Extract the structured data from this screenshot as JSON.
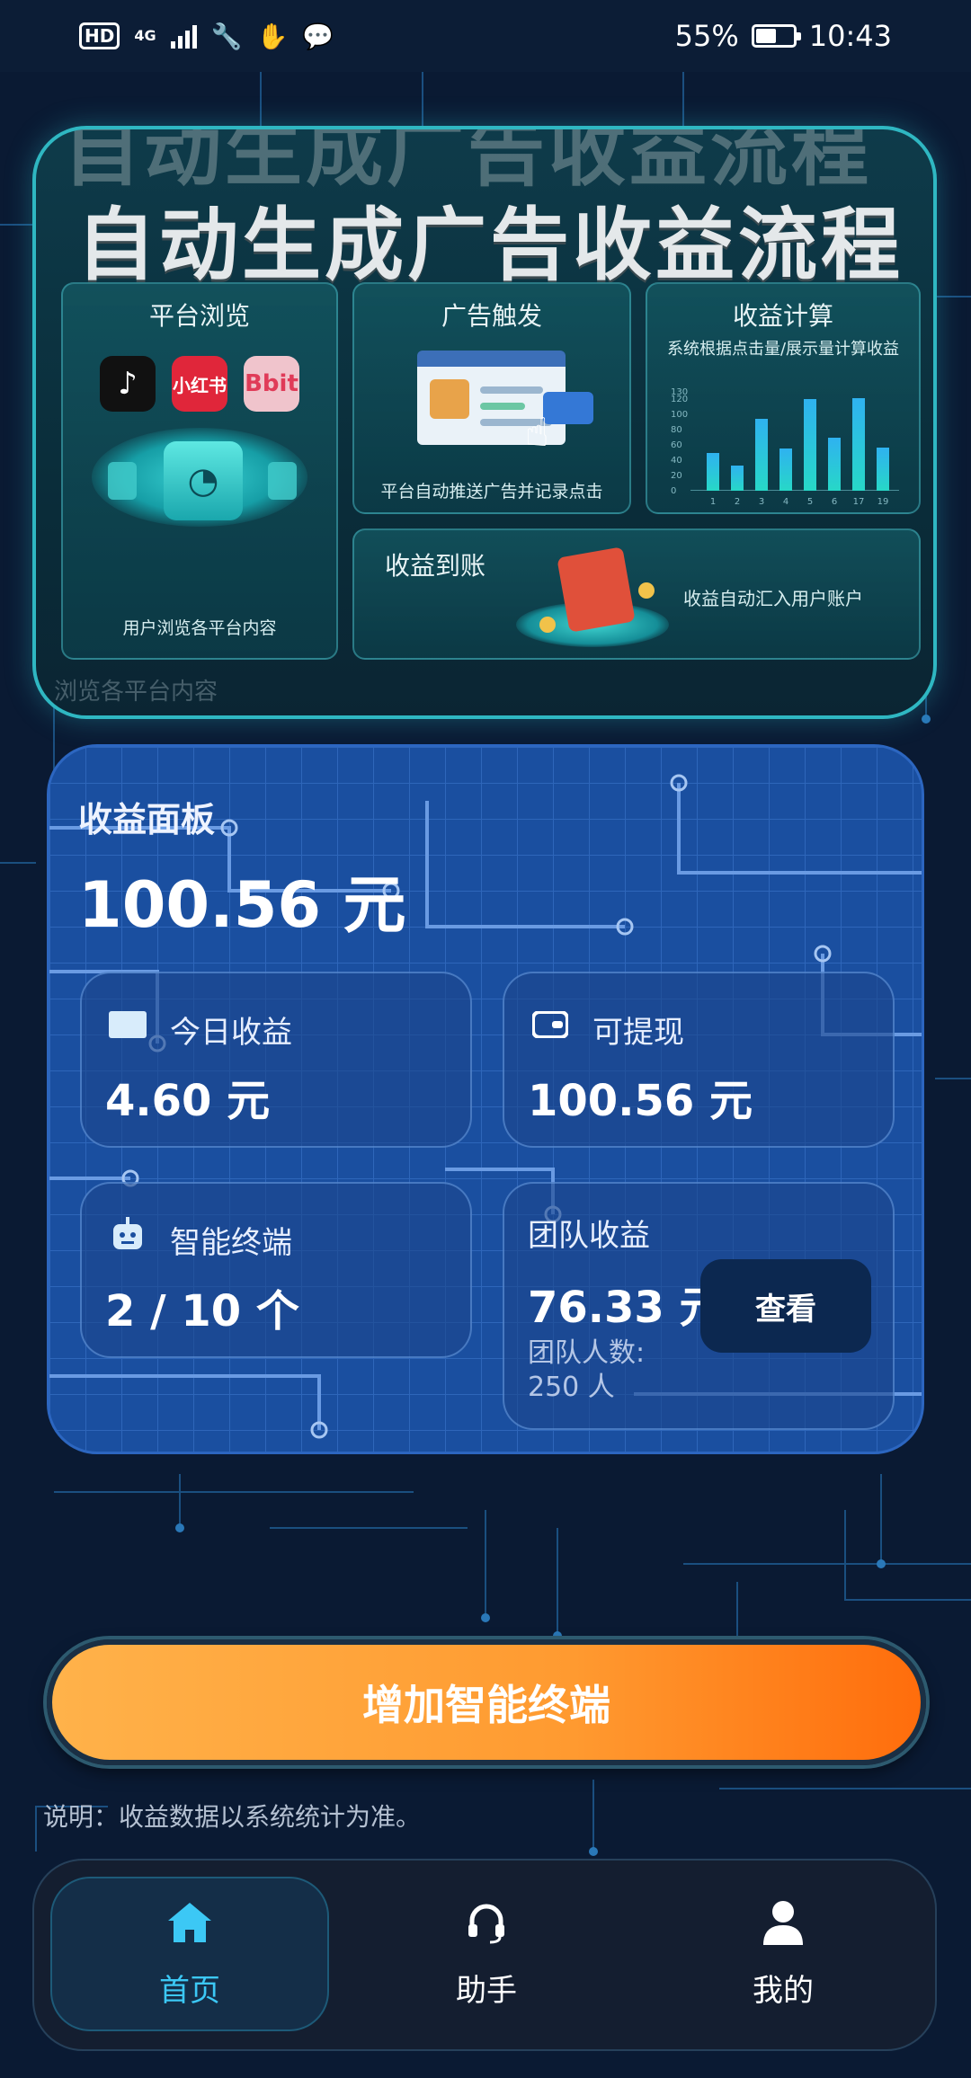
{
  "status_bar": {
    "hd": "HD",
    "network": "4G",
    "battery": "55%",
    "battery_level": 0.55,
    "time": "10:43"
  },
  "banner": {
    "title": "自动生成广告收益流程",
    "ghost_title": "自动生成广告收益流程",
    "ghost_caption": "浏览各平台内容",
    "platform_browse": {
      "title": "平台浏览",
      "caption": "用户浏览各平台内容",
      "apps": [
        "tiktok-logo",
        "小红书",
        "Bbit"
      ]
    },
    "ad_trigger": {
      "title": "广告触发",
      "caption": "平台自动推送广告并记录点击"
    },
    "earnings_calc": {
      "title": "收益计算",
      "subtitle": "系统根据点击量/展示量计算收益",
      "chart_data": {
        "type": "bar",
        "categories": [
          "1",
          "2",
          "3",
          "4",
          "5",
          "6",
          "17",
          "19"
        ],
        "values": [
          50,
          33,
          95,
          55,
          120,
          70,
          122,
          57
        ],
        "ylim": [
          0,
          130
        ],
        "yticks": [
          "0",
          "20",
          "40",
          "60",
          "80",
          "100",
          "120",
          "130"
        ],
        "colors": [
          "#2fb2f0",
          "#27d8c7"
        ]
      }
    },
    "earnings_arrive": {
      "title": "收益到账",
      "caption": "收益自动汇入用户账户"
    }
  },
  "panel": {
    "title": "收益面板",
    "total": "100.56 元",
    "today": {
      "label": "今日收益",
      "value": "4.60 元"
    },
    "withdrawable": {
      "label": "可提现",
      "value": "100.56 元"
    },
    "terminals": {
      "label": "智能终端",
      "value": "2 / 10 个"
    },
    "team": {
      "label": "团队收益",
      "value": "76.33 元",
      "count_label": "团队人数:",
      "count_value": "250 人",
      "view_button": "查看"
    }
  },
  "cta": {
    "label": "增加智能终端"
  },
  "note": "说明：收益数据以系统统计为准。",
  "nav": [
    {
      "label": "首页",
      "icon": "home-icon",
      "active": true
    },
    {
      "label": "助手",
      "icon": "headset-icon",
      "active": false
    },
    {
      "label": "我的",
      "icon": "user-icon",
      "active": false
    }
  ],
  "colors": {
    "accent_cyan": "#3cc8f5",
    "cta_orange": "#ff9a30",
    "panel_blue": "#1a4fa0",
    "background": "#0a1a33"
  }
}
